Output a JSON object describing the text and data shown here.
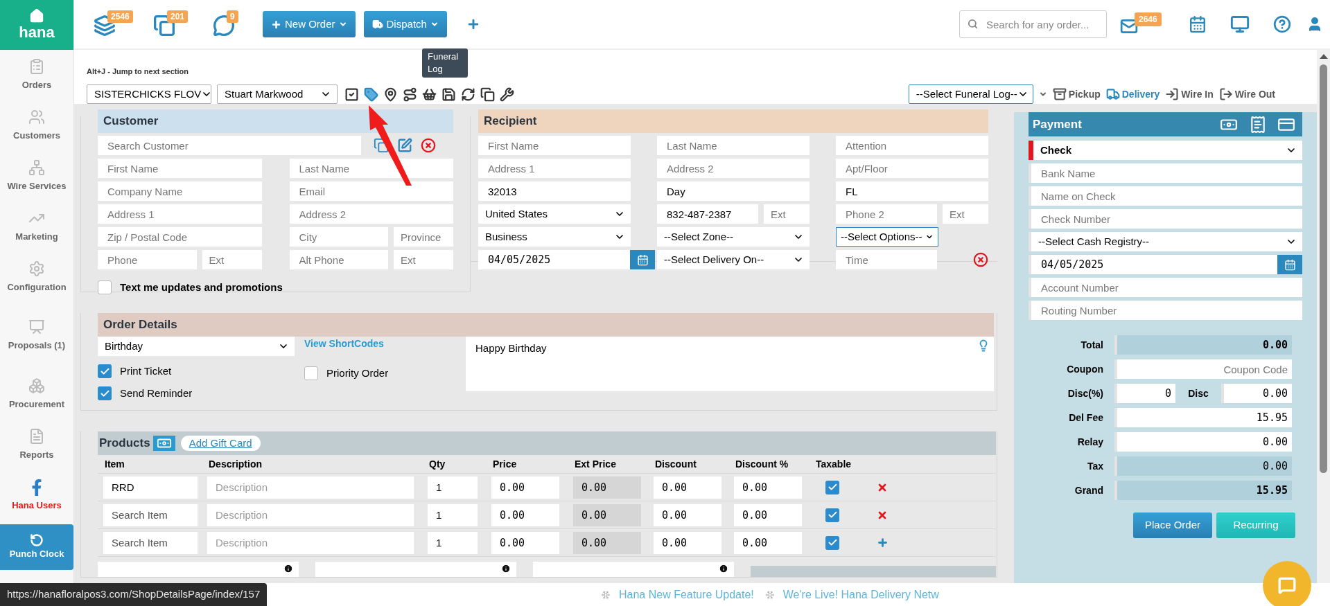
{
  "sidebar": {
    "logo": "hana",
    "items": [
      {
        "label": "Orders",
        "kind": "nav"
      },
      {
        "label": "Customers",
        "kind": "nav"
      },
      {
        "label": "Wire Services",
        "kind": "nav"
      },
      {
        "label": "Marketing",
        "kind": "nav"
      },
      {
        "label": "Configuration",
        "kind": "nav"
      },
      {
        "label": "Proposals (1)",
        "kind": "nav"
      },
      {
        "label": "Procurement",
        "kind": "nav"
      },
      {
        "label": "Reports",
        "kind": "nav"
      },
      {
        "label": "Hana Users",
        "kind": "social"
      }
    ],
    "punch_clock": "Punch Clock"
  },
  "header": {
    "counters": [
      {
        "badge": "2546"
      },
      {
        "badge": "201"
      },
      {
        "badge": "9"
      }
    ],
    "buttons": [
      "New Order",
      "Dispatch"
    ],
    "search": {
      "placeholder": "Search for any order..."
    },
    "mail_badge": "2646"
  },
  "toolbar": {
    "hint": "Alt+J - Jump to next section",
    "shop": "SISTERCHICKS FLOV",
    "employee": "Stuart Markwood",
    "tooltip": "Funeral Log",
    "funeral_log": "--Select Funeral Log--",
    "order_types": [
      {
        "label": "Pickup",
        "selected": false
      },
      {
        "label": "Delivery",
        "selected": true
      },
      {
        "label": "Wire In",
        "selected": false
      },
      {
        "label": "Wire Out",
        "selected": false
      }
    ]
  },
  "customer": {
    "title": "Customer",
    "search": {
      "placeholder": "Search Customer"
    },
    "rows": [
      [
        [
          {
            "kind": "input",
            "placeholder": "First Name"
          }
        ],
        [
          {
            "kind": "input",
            "placeholder": "Last Name"
          }
        ]
      ],
      [
        [
          {
            "kind": "input",
            "placeholder": "Company Name"
          }
        ],
        [
          {
            "kind": "input",
            "placeholder": "Email"
          }
        ]
      ],
      [
        [
          {
            "kind": "input",
            "placeholder": "Address 1"
          }
        ],
        [
          {
            "kind": "input",
            "placeholder": "Address 2"
          }
        ]
      ],
      [
        [
          {
            "kind": "input",
            "placeholder": "Zip / Postal Code"
          }
        ],
        [
          {
            "kind": "input",
            "placeholder": "City"
          },
          {
            "kind": "input",
            "placeholder": "Province"
          }
        ]
      ],
      [
        [
          {
            "kind": "input",
            "placeholder": "Phone"
          },
          {
            "kind": "input",
            "placeholder": "Ext"
          }
        ],
        [
          {
            "kind": "input",
            "placeholder": "Alt Phone"
          },
          {
            "kind": "input",
            "placeholder": "Ext"
          }
        ]
      ]
    ],
    "opt_in": {
      "label": "Text me updates and promotions",
      "checked": false
    }
  },
  "recipient": {
    "title": "Recipient",
    "rows": [
      [
        [
          {
            "kind": "input",
            "placeholder": "First Name"
          }
        ],
        [
          {
            "kind": "input",
            "placeholder": "Last Name"
          }
        ],
        [
          {
            "kind": "input",
            "placeholder": "Attention"
          }
        ]
      ],
      [
        [
          {
            "kind": "input",
            "placeholder": "Address 1"
          }
        ],
        [
          {
            "kind": "input",
            "placeholder": "Address 2"
          }
        ],
        [
          {
            "kind": "input",
            "placeholder": "Apt/Floor"
          }
        ]
      ],
      [
        [
          {
            "kind": "input",
            "value": "32013"
          }
        ],
        [
          {
            "kind": "input",
            "value": "Day"
          }
        ],
        [
          {
            "kind": "input",
            "value": "FL"
          }
        ]
      ],
      [
        [
          {
            "kind": "select",
            "value": "United States"
          }
        ],
        [
          {
            "kind": "input",
            "value": "832-487-2387"
          },
          {
            "kind": "input",
            "placeholder": "Ext"
          }
        ],
        [
          {
            "kind": "input",
            "placeholder": "Phone 2"
          },
          {
            "kind": "input",
            "placeholder": "Ext"
          }
        ]
      ],
      [
        [
          {
            "kind": "select",
            "value": "Business"
          }
        ],
        [
          {
            "kind": "select",
            "value": "--Select Zone--"
          }
        ],
        [
          {
            "kind": "options",
            "value": "--Select Options--"
          }
        ]
      ],
      [
        [
          {
            "kind": "date",
            "value": "04/05/2025"
          }
        ],
        [
          {
            "kind": "select",
            "value": "--Select Delivery On--"
          }
        ],
        [
          {
            "kind": "input",
            "placeholder": "Time"
          },
          {
            "kind": "clear"
          }
        ]
      ]
    ]
  },
  "order_details": {
    "title": "Order Details",
    "occasion": "Birthday",
    "shortcodes_link": "View ShortCodes",
    "message": "Happy Birthday",
    "options": [
      {
        "label": "Print Ticket",
        "checked": true
      },
      {
        "label": "Send Reminder",
        "checked": true
      },
      {
        "label": "Priority Order",
        "checked": false
      }
    ]
  },
  "products": {
    "title": "Products",
    "gift_card": "Add Gift Card",
    "columns": [
      "Item",
      "Description",
      "Qty",
      "Price",
      "Ext Price",
      "Discount",
      "Discount %",
      "Taxable"
    ],
    "rows": [
      {
        "item": {
          "value": "RRD"
        },
        "description": {
          "placeholder": "Description"
        },
        "qty": "1",
        "price": "0.00",
        "ext_price": "0.00",
        "discount": "0.00",
        "discount_pct": "0.00",
        "taxable": true,
        "kind": "remove"
      },
      {
        "item": {
          "placeholder": "Search Item"
        },
        "description": {
          "placeholder": "Description"
        },
        "qty": "1",
        "price": "0.00",
        "ext_price": "0.00",
        "discount": "0.00",
        "discount_pct": "0.00",
        "taxable": true,
        "kind": "remove"
      },
      {
        "item": {
          "placeholder": "Search Item"
        },
        "description": {
          "placeholder": "Description"
        },
        "qty": "1",
        "price": "0.00",
        "ext_price": "0.00",
        "discount": "0.00",
        "discount_pct": "0.00",
        "taxable": true,
        "kind": "add"
      }
    ]
  },
  "payment": {
    "title": "Payment",
    "method": "Check",
    "fields": [
      {
        "kind": "input",
        "placeholder": "Bank Name"
      },
      {
        "kind": "input",
        "placeholder": "Name on Check"
      },
      {
        "kind": "input",
        "placeholder": "Check Number"
      },
      {
        "kind": "select",
        "value": "--Select Cash Registry--"
      },
      {
        "kind": "date",
        "value": "04/05/2025"
      },
      {
        "kind": "input",
        "placeholder": "Account Number"
      },
      {
        "kind": "input",
        "placeholder": "Routing Number"
      }
    ],
    "totals": [
      {
        "kind": "sum",
        "label": "Total",
        "value": "0.00"
      },
      {
        "kind": "input",
        "label": "Coupon",
        "placeholder": "Coupon Code"
      },
      {
        "kind": "split",
        "label": "Disc(%)",
        "value": "0",
        "label2": "Disc",
        "value2": "0.00"
      },
      {
        "kind": "input",
        "label": "Del Fee",
        "value": "15.95"
      },
      {
        "kind": "input",
        "label": "Relay",
        "value": "0.00"
      },
      {
        "kind": "readonly",
        "label": "Tax",
        "value": "0.00"
      },
      {
        "kind": "sum",
        "label": "Grand",
        "value": "15.95"
      }
    ],
    "buttons": [
      {
        "label": "Place Order",
        "kind": "primary"
      },
      {
        "label": "Recurring",
        "kind": "secondary"
      }
    ]
  },
  "status_bar": {
    "url": "https://hanafloralpos3.com/ShopDetailsPage/index/157",
    "news": [
      "Hana New Feature Update!",
      "We're Live! Hana Delivery Netw"
    ]
  }
}
